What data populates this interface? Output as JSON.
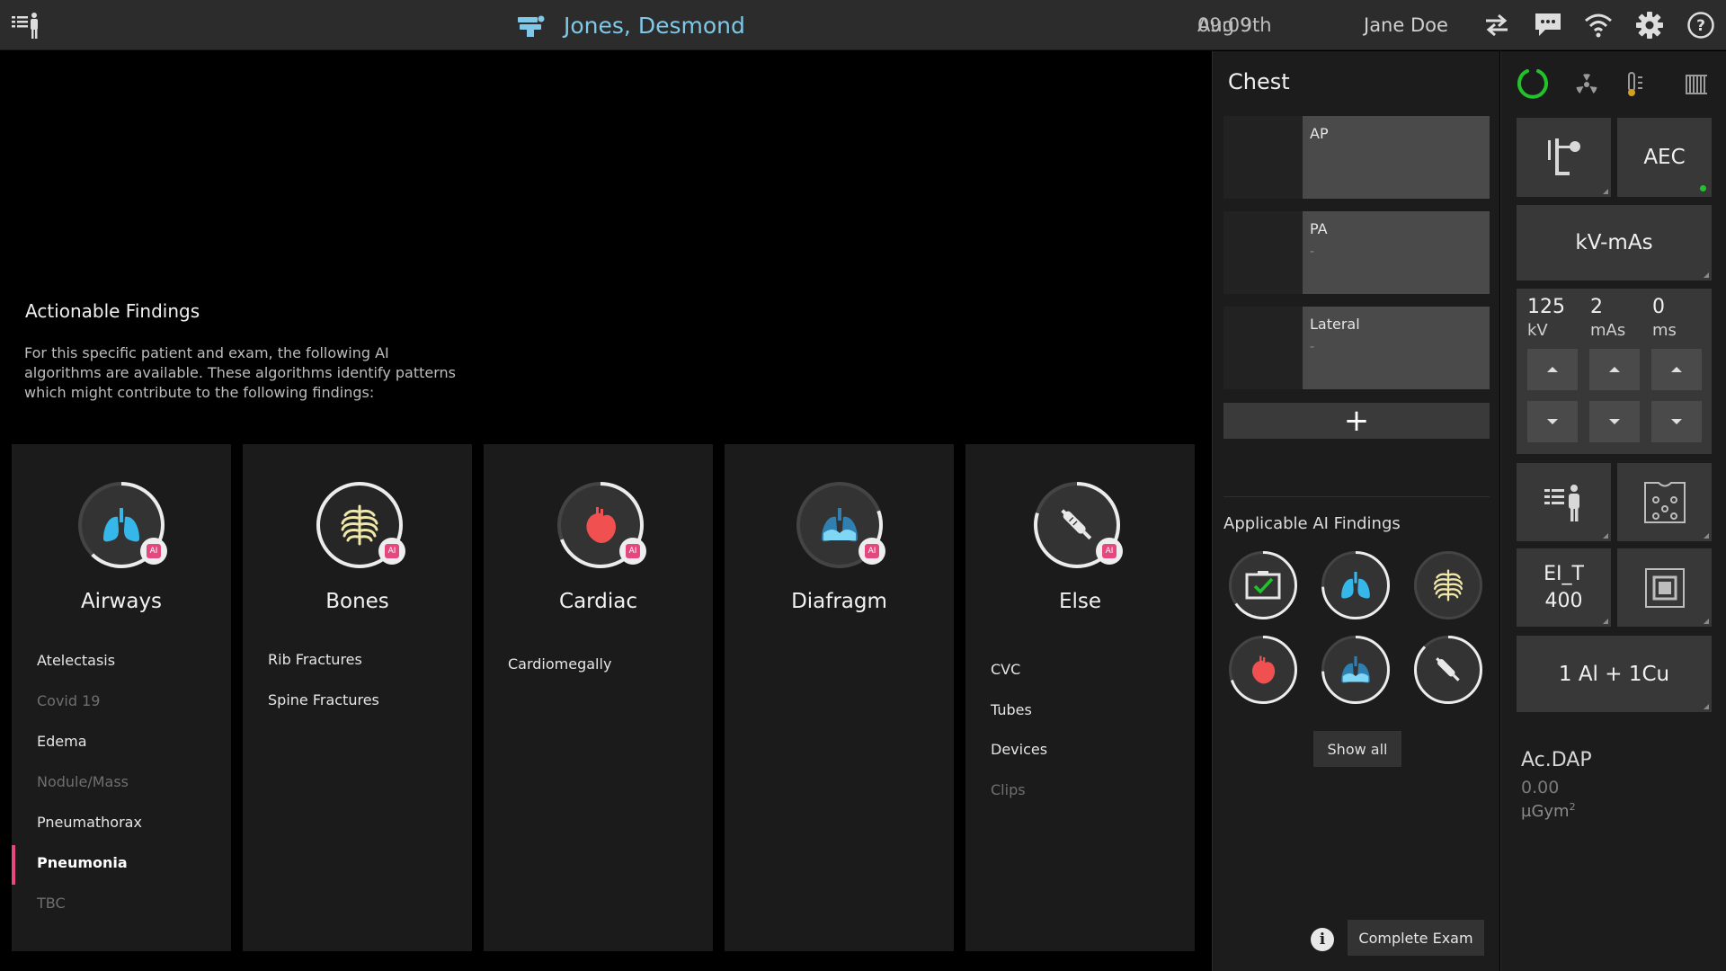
{
  "topbar": {
    "patient_name": "Jones, Desmond",
    "date": "Aug 9th",
    "time": "09:09",
    "user": "Jane Doe",
    "icons": [
      "menu-patient-icon",
      "patient-table-icon",
      "swap-icon",
      "chat-icon",
      "wifi-icon",
      "settings-icon",
      "help-icon"
    ]
  },
  "findings": {
    "title": "Actionable Findings",
    "description": "For this specific patient and exam, the following AI algorithms are available. These algorithms identify patterns which might contribute to the following findings:"
  },
  "categories": [
    {
      "name": "Airways",
      "icon": "lungs-icon",
      "items": [
        "Atelectasis",
        "Covid 19",
        "Edema",
        "Nodule/Mass",
        "Pneumathorax",
        "Pneumonia",
        "TBC"
      ],
      "dim": [
        false,
        true,
        false,
        true,
        false,
        false,
        true
      ],
      "active_index": 5
    },
    {
      "name": "Bones",
      "icon": "ribcage-icon",
      "items": [
        "Rib Fractures",
        "Spine Fractures"
      ]
    },
    {
      "name": "Cardiac",
      "icon": "heart-icon",
      "items": [
        "Cardiomegally"
      ]
    },
    {
      "name": "Diafragm",
      "icon": "diaphragm-icon",
      "items": []
    },
    {
      "name": "Else",
      "icon": "device-icon",
      "items": [
        "CVC",
        "Tubes",
        "Devices",
        "Clips"
      ],
      "dim": [
        false,
        false,
        false,
        true
      ]
    }
  ],
  "ai_badge": "AI",
  "exam": {
    "title": "Chest",
    "views": [
      {
        "label": "AP",
        "sub": ""
      },
      {
        "label": "PA",
        "sub": "-"
      },
      {
        "label": "Lateral",
        "sub": "-"
      }
    ],
    "add_label": "+",
    "ai_findings_title": "Applicable AI Findings",
    "show_all": "Show all",
    "complete_exam": "Complete Exam",
    "info_label": "i"
  },
  "acquisition": {
    "aec": "AEC",
    "technique": "kV-mAs",
    "kv": {
      "value": "125",
      "unit": "kV"
    },
    "mas": {
      "value": "2",
      "unit": "mAs"
    },
    "ms": {
      "value": "0",
      "unit": "ms"
    },
    "ei_label": "EI_T",
    "ei_value": "400",
    "filter": "1 Al + 1Cu",
    "dap_label": "Ac.DAP",
    "dap_value": "0.00",
    "dap_unit": "µGym",
    "dap_unit_sup": "2"
  },
  "colors": {
    "accent_pink": "#e5487f",
    "patient_blue": "#7fc8e8",
    "ready_green": "#22c22a",
    "lung_blue": "#35b7ea",
    "heart_red": "#f05050",
    "bone_yellow": "#f0e8a8"
  }
}
